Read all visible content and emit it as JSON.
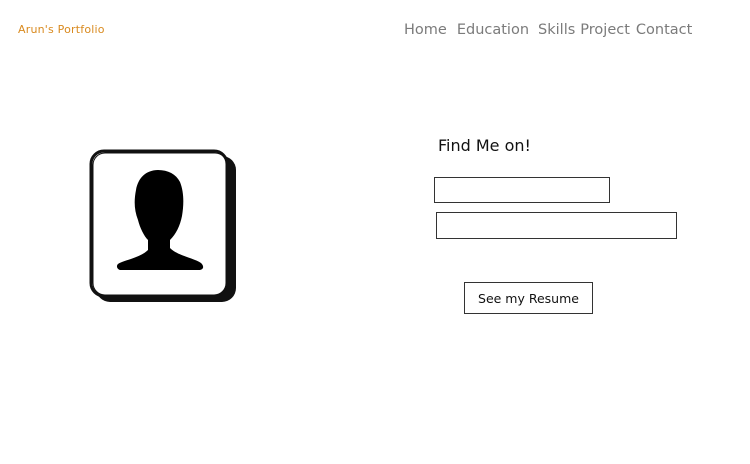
{
  "header": {
    "brand": "Arun's Portfolio",
    "nav": [
      "Home",
      "Education",
      "Skills",
      "Project",
      "Contact"
    ]
  },
  "main": {
    "avatar_icon": "person-silhouette-icon",
    "find_title": "Find Me on!",
    "resume_button_label": "See my Resume"
  },
  "colors": {
    "brand": "#d98a1f",
    "nav": "#7b7b7b",
    "stroke": "#111111"
  }
}
